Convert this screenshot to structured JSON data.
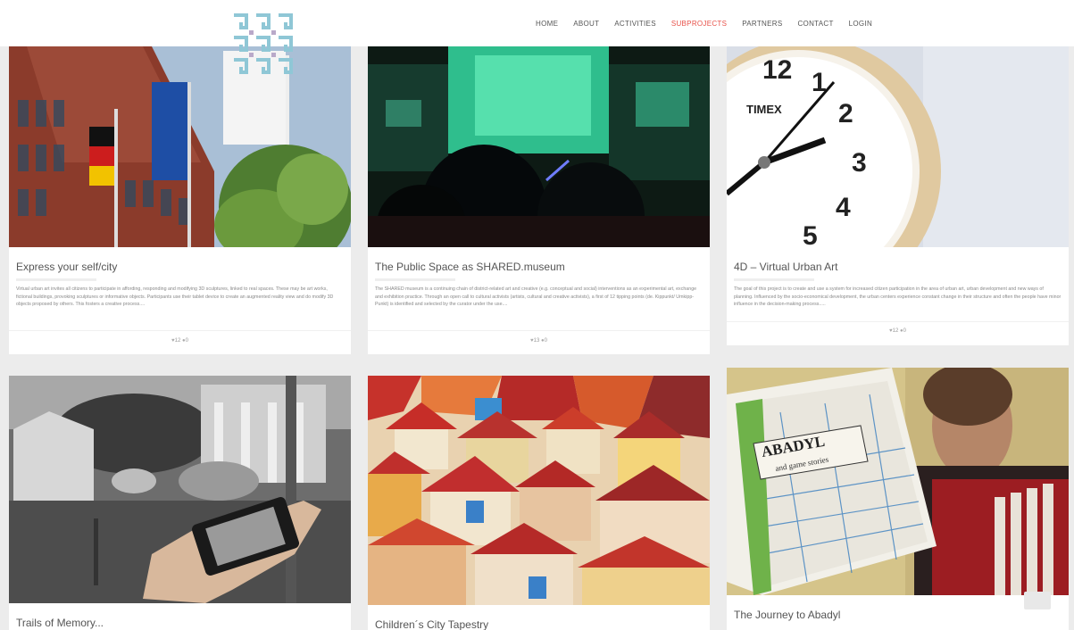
{
  "nav": {
    "items": [
      {
        "label": "HOME",
        "active": false
      },
      {
        "label": "ABOUT",
        "active": false
      },
      {
        "label": "ACTIVITIES",
        "active": false
      },
      {
        "label": "SUBPROJECTS",
        "active": true
      },
      {
        "label": "PARTNERS",
        "active": false
      },
      {
        "label": "CONTACT",
        "active": false
      },
      {
        "label": "LOGIN",
        "active": false
      }
    ]
  },
  "colors": {
    "accent": "#e8524a",
    "logo": "#8fc7d6"
  },
  "cards": [
    {
      "title": "Express your self/city",
      "description": "Virtual urban art invites all citizens to participate in affording, responding and modifying 3D sculptures, linked to real spaces. These may be art works, fictional buildings, provoking sculptures or informative objects. Participants use their tablet device to create an augmented reality view and do modify 3D objects proposed by others. This fosters a creative process....",
      "likes": "12",
      "comments": "0"
    },
    {
      "title": "The Public Space as SHARED.museum",
      "description": "The SHARED museum is a continuing chain of district-related art and creative (e.g. conceptual and social) interventions as an experimental art, exchange and exhibition practice. Through an open call to cultural activists (artists, cultural and creative activists), a first of 12 tipping points (de. Kippunkt/ Umkipp-Punkt) is identified and selected by the curator under the use....",
      "likes": "13",
      "comments": "0"
    },
    {
      "title": "4D – Virtual Urban Art",
      "description": "The goal of this project is to create and use a system for increased citizen participation in the area of urban art, urban development and new ways of planning. Influenced by the socio-economical development, the urban centers experience constant change in their structure and often the people have minor influence in the decision-making process.....",
      "likes": "12",
      "comments": "0"
    },
    {
      "title": "Trails of Memory..."
    },
    {
      "title": "Children´s City Tapestry"
    },
    {
      "title": "The Journey to Abadyl"
    }
  ]
}
